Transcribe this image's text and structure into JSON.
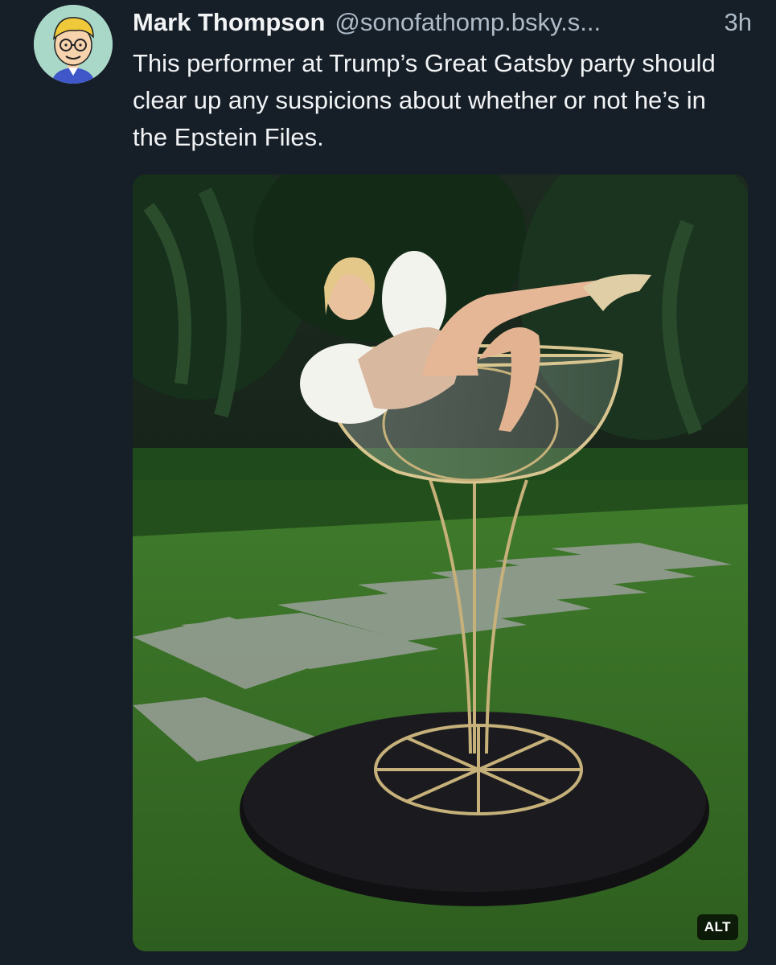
{
  "post": {
    "author": {
      "display_name": "Mark Thompson",
      "handle": "@sonofathomp.bsky.s...",
      "avatar_icon": "cartoon-man-avatar"
    },
    "timestamp": "3h",
    "text": "This performer at Trump’s Great Gatsby party should clear up any suspicions about whether or not he’s in the Epstein Files.",
    "media": {
      "alt_badge": "ALT"
    }
  },
  "colors": {
    "background": "#161e27",
    "text_primary": "#f1f3f5",
    "text_secondary": "#aebbc9",
    "avatar_bg": "#a9d8c9"
  }
}
